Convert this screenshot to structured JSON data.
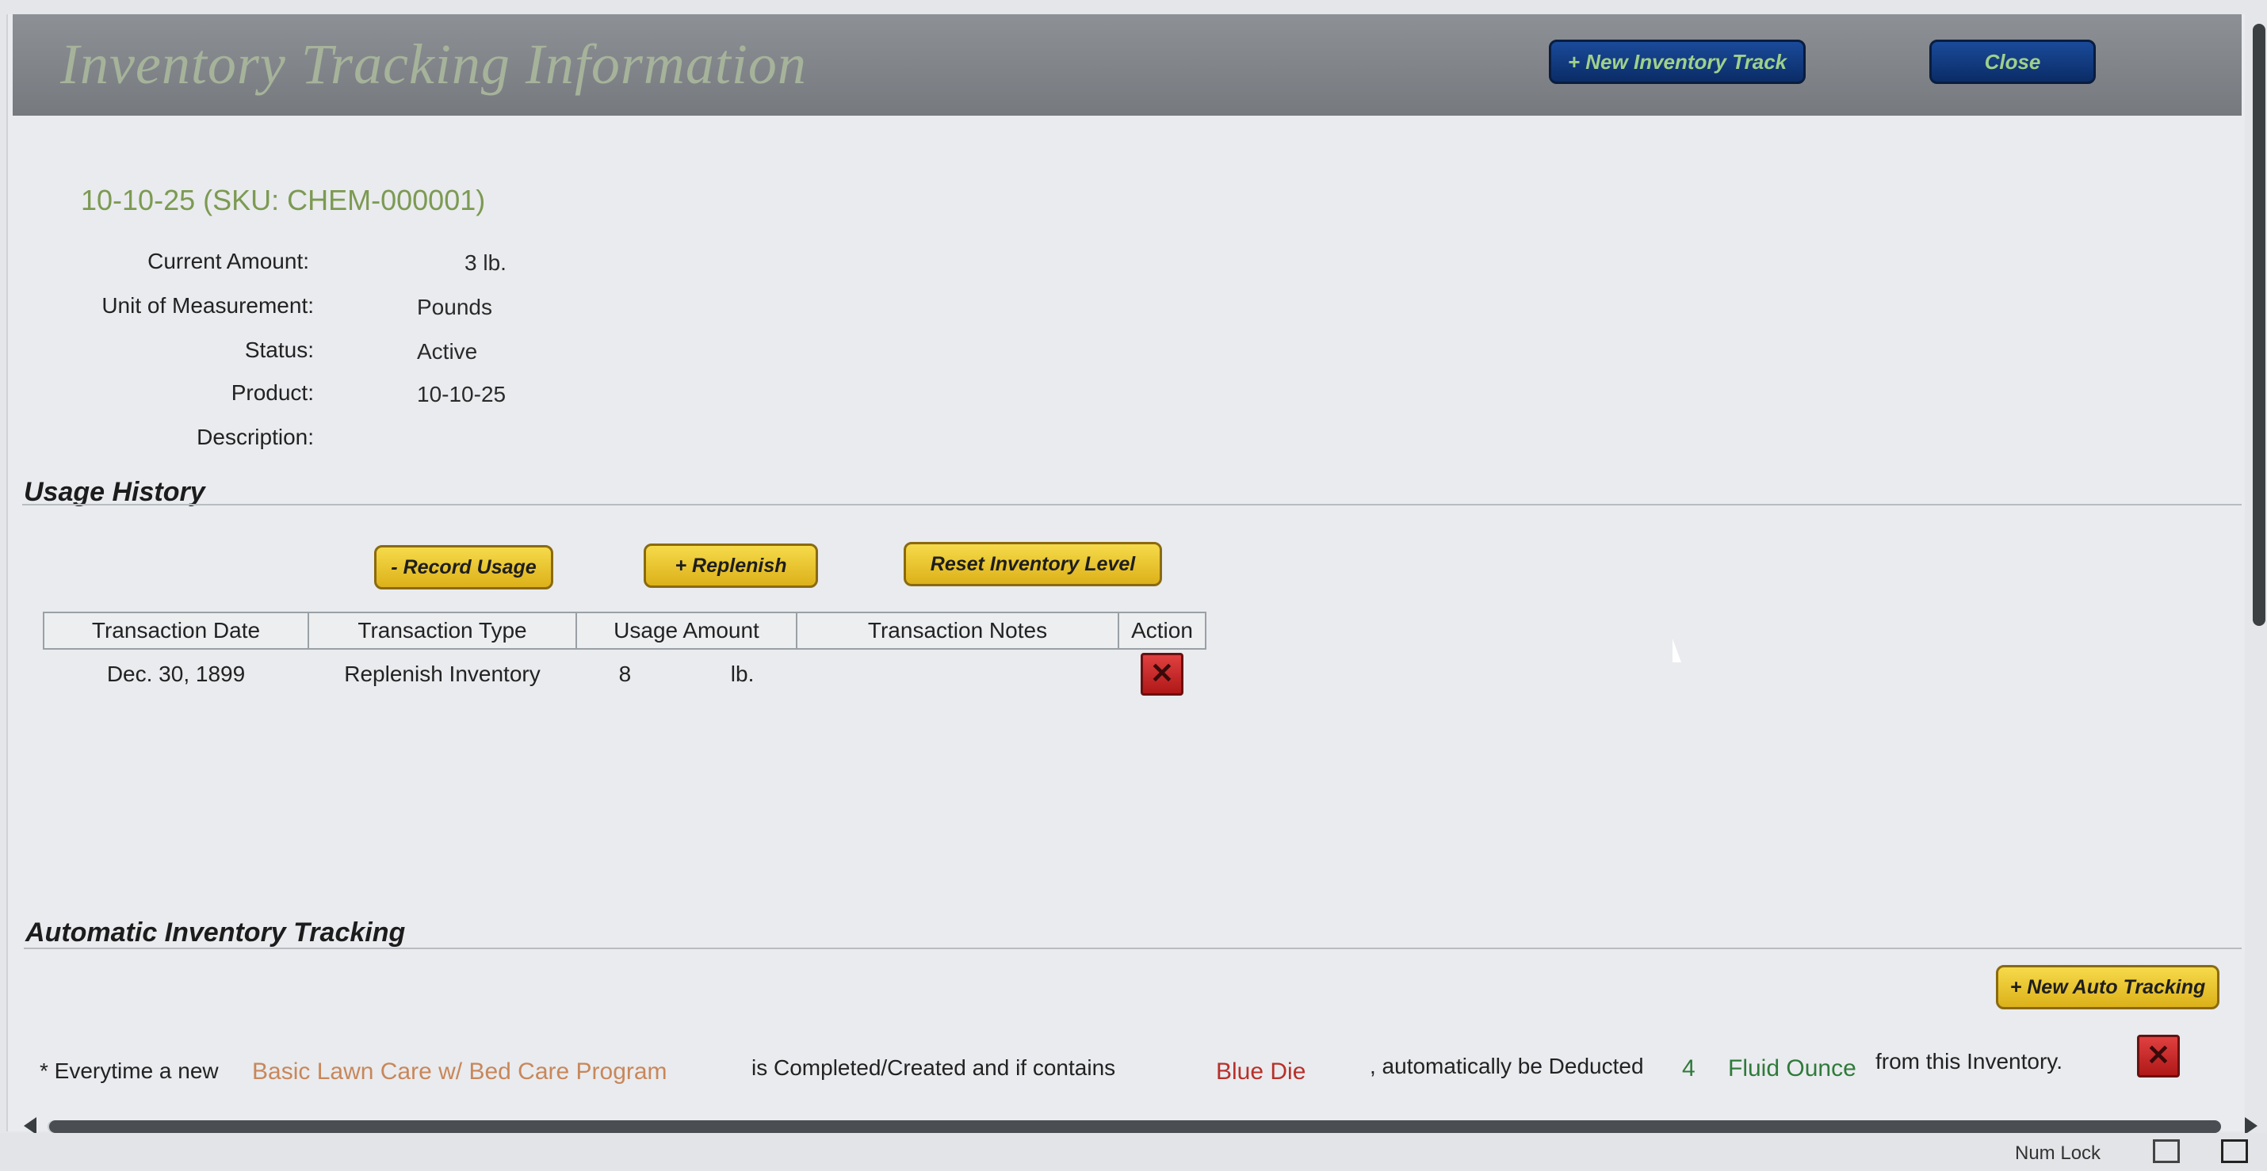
{
  "header": {
    "title": "Inventory Tracking Information",
    "new_track_label": "+ New Inventory Track",
    "close_label": "Close"
  },
  "item": {
    "sku_title": "10-10-25 (SKU: CHEM-000001)",
    "fields": [
      {
        "label": "Current Amount:",
        "value": "3 lb."
      },
      {
        "label": "Unit of Measurement:",
        "value": "Pounds"
      },
      {
        "label": "Status:",
        "value": "Active"
      },
      {
        "label": "Product:",
        "value": "10-10-25"
      },
      {
        "label": "Description:",
        "value": ""
      }
    ]
  },
  "usage": {
    "section_title": "Usage History",
    "record_usage_label": "- Record Usage",
    "replenish_label": "+ Replenish",
    "reset_label": "Reset Inventory Level",
    "columns": [
      "Transaction Date",
      "Transaction Type",
      "Usage Amount",
      "Transaction Notes",
      "Action"
    ],
    "rows": [
      {
        "date": "Dec. 30, 1899",
        "type": "Replenish Inventory",
        "amount": "8",
        "unit": "lb.",
        "notes": ""
      }
    ]
  },
  "auto": {
    "section_title": "Automatic Inventory Tracking",
    "new_auto_label": "+ New Auto Tracking",
    "rule": {
      "prefix": "* Everytime a new",
      "program": "Basic Lawn Care w/ Bed Care Program",
      "mid": "is Completed/Created and if contains",
      "material": "Blue Die",
      "deduct_text": ", automatically be Deducted",
      "quantity": "4",
      "unit": "Fluid Ounce",
      "suffix": "from this Inventory."
    }
  },
  "statusbar": {
    "numlock": "Num Lock"
  },
  "colors": {
    "accent_green": "#7c9a52",
    "program_orange": "#c8875a",
    "material_red": "#b8302a",
    "unit_green": "#2f7a3a",
    "button_gold": "#e8c22c",
    "button_navy": "#12387d"
  }
}
